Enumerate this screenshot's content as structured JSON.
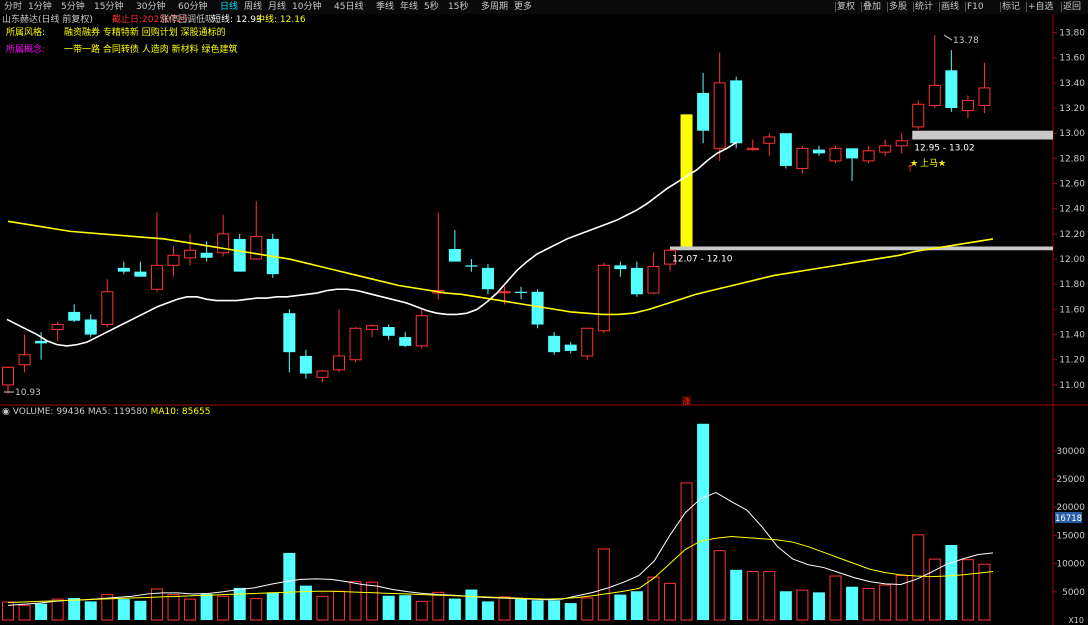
{
  "toolbar": {
    "periods": [
      "分时",
      "1分钟",
      "5分钟",
      "15分钟",
      "30分钟",
      "60分钟",
      "日线",
      "周线",
      "月线",
      "10分钟",
      "45日线",
      "季线",
      "年线",
      "5秒",
      "15秒",
      "多周期",
      "更多"
    ],
    "active_period": "日线",
    "right_buttons": [
      "复权",
      "叠加",
      "多股",
      "统计",
      "画线",
      "F10",
      "标记",
      "+自选",
      "返回"
    ]
  },
  "header": {
    "stock": "山东赫达(日线 前复权)",
    "date": "截止日:20250725",
    "strategy": "涨停回调低吸",
    "line1": "短线: 12.93",
    "line2": "中线: 12.16"
  },
  "info": {
    "style_label": "所属风格:",
    "style_value": "融资融券 专精特新 回购计划 深股通标的",
    "concept_label": "所属概念:",
    "concept_value": "一带一路 合同转债 人造肉 新材料 绿色建筑"
  },
  "volume_header": {
    "volume": "VOLUME: 99436",
    "ma5": "MA5: 119580",
    "ma10": "MA10: 85655"
  },
  "volume_badge": "16718",
  "volume_unit": "X10",
  "colors": {
    "up": "#ff3232",
    "down": "#54ffff",
    "short_line": "#ffffff",
    "mid_line": "#ffff00",
    "marker": "#ffff00",
    "zone": "#c8c8c8"
  },
  "chart_data": {
    "type": "candlestick",
    "price_axis": {
      "ylim": [
        10.88,
        13.86
      ],
      "ticks": [
        11.0,
        11.2,
        11.4,
        11.6,
        11.8,
        12.0,
        12.2,
        12.4,
        12.6,
        12.8,
        13.0,
        13.2,
        13.4,
        13.6,
        13.8
      ],
      "tick_labels": [
        "11.00",
        "11.20",
        "11.40",
        "11.60",
        "11.80",
        "12.00",
        "12.20",
        "12.40",
        "12.60",
        "12.80",
        "13.00",
        "13.20",
        "13.40",
        "13.60",
        "13.80"
      ]
    },
    "volume_axis": {
      "ylim": [
        0,
        36000
      ],
      "ticks": [
        5000,
        10000,
        15000,
        20000,
        25000,
        30000
      ],
      "tick_labels": [
        "5000",
        "10000",
        "15000",
        "20000",
        "25000",
        "30000"
      ]
    },
    "candles": [
      {
        "o": 11.0,
        "h": 11.15,
        "l": 10.93,
        "c": 11.14
      },
      {
        "o": 11.16,
        "h": 11.4,
        "l": 11.1,
        "c": 11.24
      },
      {
        "o": 11.35,
        "h": 11.42,
        "l": 11.2,
        "c": 11.33
      },
      {
        "o": 11.44,
        "h": 11.5,
        "l": 11.35,
        "c": 11.48
      },
      {
        "o": 11.58,
        "h": 11.64,
        "l": 11.5,
        "c": 11.51
      },
      {
        "o": 11.52,
        "h": 11.56,
        "l": 11.38,
        "c": 11.4
      },
      {
        "o": 11.48,
        "h": 11.84,
        "l": 11.46,
        "c": 11.74
      },
      {
        "o": 11.93,
        "h": 11.98,
        "l": 11.88,
        "c": 11.9
      },
      {
        "o": 11.9,
        "h": 11.98,
        "l": 11.86,
        "c": 11.86
      },
      {
        "o": 11.76,
        "h": 12.37,
        "l": 11.74,
        "c": 11.95
      },
      {
        "o": 11.95,
        "h": 12.1,
        "l": 11.86,
        "c": 12.03
      },
      {
        "o": 12.01,
        "h": 12.2,
        "l": 11.95,
        "c": 12.07
      },
      {
        "o": 12.05,
        "h": 12.14,
        "l": 11.98,
        "c": 12.01
      },
      {
        "o": 12.05,
        "h": 12.35,
        "l": 12.02,
        "c": 12.2
      },
      {
        "o": 12.16,
        "h": 12.2,
        "l": 11.92,
        "c": 11.9
      },
      {
        "o": 12.0,
        "h": 12.46,
        "l": 12.0,
        "c": 12.18
      },
      {
        "o": 12.16,
        "h": 12.2,
        "l": 11.85,
        "c": 11.88
      },
      {
        "o": 11.57,
        "h": 11.6,
        "l": 11.1,
        "c": 11.26
      },
      {
        "o": 11.23,
        "h": 11.28,
        "l": 11.05,
        "c": 11.09
      },
      {
        "o": 11.06,
        "h": 11.12,
        "l": 11.02,
        "c": 11.11
      },
      {
        "o": 11.12,
        "h": 11.6,
        "l": 11.1,
        "c": 11.23
      },
      {
        "o": 11.2,
        "h": 11.46,
        "l": 11.18,
        "c": 11.45
      },
      {
        "o": 11.44,
        "h": 11.48,
        "l": 11.38,
        "c": 11.47
      },
      {
        "o": 11.46,
        "h": 11.48,
        "l": 11.36,
        "c": 11.39
      },
      {
        "o": 11.38,
        "h": 11.42,
        "l": 11.3,
        "c": 11.31
      },
      {
        "o": 11.31,
        "h": 11.6,
        "l": 11.29,
        "c": 11.55
      },
      {
        "o": 11.73,
        "h": 12.37,
        "l": 11.68,
        "c": 11.75
      },
      {
        "o": 12.08,
        "h": 12.23,
        "l": 11.98,
        "c": 11.98
      },
      {
        "o": 11.95,
        "h": 12.0,
        "l": 11.9,
        "c": 11.94
      },
      {
        "o": 11.93,
        "h": 11.96,
        "l": 11.72,
        "c": 11.76
      },
      {
        "o": 11.74,
        "h": 11.78,
        "l": 11.64,
        "c": 11.74
      },
      {
        "o": 11.74,
        "h": 11.78,
        "l": 11.68,
        "c": 11.73
      },
      {
        "o": 11.74,
        "h": 11.76,
        "l": 11.45,
        "c": 11.48
      },
      {
        "o": 11.39,
        "h": 11.42,
        "l": 11.24,
        "c": 11.26
      },
      {
        "o": 11.32,
        "h": 11.34,
        "l": 11.25,
        "c": 11.27
      },
      {
        "o": 11.23,
        "h": 11.44,
        "l": 11.2,
        "c": 11.45
      },
      {
        "o": 11.43,
        "h": 11.97,
        "l": 11.41,
        "c": 11.95
      },
      {
        "o": 11.95,
        "h": 11.98,
        "l": 11.86,
        "c": 11.92
      },
      {
        "o": 11.93,
        "h": 11.98,
        "l": 11.7,
        "c": 11.72
      },
      {
        "o": 11.73,
        "h": 12.05,
        "l": 11.72,
        "c": 11.94
      },
      {
        "o": 11.96,
        "h": 12.08,
        "l": 11.9,
        "c": 12.07
      },
      {
        "o": 12.17,
        "h": 13.15,
        "l": 12.17,
        "c": 13.15
      },
      {
        "o": 13.32,
        "h": 13.48,
        "l": 12.92,
        "c": 13.02
      },
      {
        "o": 12.88,
        "h": 13.64,
        "l": 12.78,
        "c": 13.4
      },
      {
        "o": 13.42,
        "h": 13.45,
        "l": 12.88,
        "c": 12.92
      },
      {
        "o": 12.87,
        "h": 12.95,
        "l": 12.86,
        "c": 12.88
      },
      {
        "o": 12.92,
        "h": 13.0,
        "l": 12.82,
        "c": 12.97
      },
      {
        "o": 13.0,
        "h": 13.0,
        "l": 12.72,
        "c": 12.74
      },
      {
        "o": 12.72,
        "h": 12.9,
        "l": 12.68,
        "c": 12.88
      },
      {
        "o": 12.87,
        "h": 12.9,
        "l": 12.82,
        "c": 12.84
      },
      {
        "o": 12.78,
        "h": 12.9,
        "l": 12.76,
        "c": 12.88
      },
      {
        "o": 12.88,
        "h": 12.88,
        "l": 12.62,
        "c": 12.8
      },
      {
        "o": 12.78,
        "h": 12.9,
        "l": 12.76,
        "c": 12.86
      },
      {
        "o": 12.85,
        "h": 12.95,
        "l": 12.82,
        "c": 12.9
      },
      {
        "o": 12.9,
        "h": 13.0,
        "l": 12.84,
        "c": 12.94
      },
      {
        "o": 13.05,
        "h": 13.26,
        "l": 13.03,
        "c": 13.23
      },
      {
        "o": 13.22,
        "h": 13.78,
        "l": 13.2,
        "c": 13.38
      },
      {
        "o": 13.5,
        "h": 13.66,
        "l": 13.17,
        "c": 13.2
      },
      {
        "o": 13.18,
        "h": 13.3,
        "l": 13.12,
        "c": 13.26
      },
      {
        "o": 13.22,
        "h": 13.56,
        "l": 13.16,
        "c": 13.36
      }
    ],
    "short_line": [
      11.52,
      11.48,
      11.44,
      11.4,
      11.35,
      11.32,
      11.31,
      11.32,
      11.34,
      11.38,
      11.42,
      11.46,
      11.5,
      11.54,
      11.58,
      11.62,
      11.65,
      11.68,
      11.7,
      11.7,
      11.68,
      11.67,
      11.67,
      11.67,
      11.68,
      11.69,
      11.69,
      11.7,
      11.7,
      11.71,
      11.72,
      11.73,
      11.75,
      11.76,
      11.76,
      11.75,
      11.73,
      11.71,
      11.69,
      11.67,
      11.65,
      11.62,
      11.59,
      11.57,
      11.56,
      11.56,
      11.57,
      11.6,
      11.66,
      11.73,
      11.82,
      11.91,
      11.98,
      12.04,
      12.08,
      12.12,
      12.16,
      12.19,
      12.22,
      12.25,
      12.28,
      12.31,
      12.35,
      12.39,
      12.44,
      12.5,
      12.56,
      12.61,
      12.66,
      12.71,
      12.78,
      12.84,
      12.88,
      12.93
    ],
    "short_x": [
      7,
      17,
      27,
      37,
      47,
      57,
      67,
      77,
      87,
      97,
      107,
      117,
      127,
      137,
      147,
      157,
      167,
      177,
      187,
      197,
      207,
      217,
      227,
      237,
      247,
      257,
      267,
      277,
      287,
      297,
      307,
      317,
      327,
      337,
      347,
      357,
      367,
      377,
      387,
      397,
      407,
      417,
      427,
      437,
      447,
      457,
      467,
      477,
      487,
      497,
      507,
      517,
      527,
      537,
      547,
      557,
      567,
      577,
      587,
      597,
      607,
      617,
      627,
      637,
      647,
      657,
      667,
      677,
      687,
      697,
      707,
      717,
      727,
      737
    ],
    "mid_line": [
      12.3,
      12.28,
      12.26,
      12.24,
      12.22,
      12.21,
      12.2,
      12.19,
      12.18,
      12.17,
      12.16,
      12.14,
      12.12,
      12.1,
      12.08,
      12.06,
      12.04,
      12.02,
      12.0,
      11.97,
      11.94,
      11.91,
      11.88,
      11.85,
      11.82,
      11.79,
      11.77,
      11.75,
      11.73,
      11.72,
      11.7,
      11.68,
      11.66,
      11.64,
      11.62,
      11.6,
      11.58,
      11.57,
      11.56,
      11.56,
      11.57,
      11.6,
      11.64,
      11.68,
      11.72,
      11.75,
      11.78,
      11.81,
      11.84,
      11.87,
      11.89,
      11.91,
      11.93,
      11.95,
      11.97,
      11.99,
      12.01,
      12.03,
      12.06,
      12.08,
      12.1,
      12.12,
      12.14,
      12.16
    ],
    "volumes": [
      3200,
      2600,
      2900,
      3700,
      3900,
      3300,
      4500,
      3700,
      3400,
      5500,
      4500,
      3700,
      4600,
      4200,
      5700,
      3800,
      4900,
      11900,
      6100,
      4200,
      5100,
      6800,
      6700,
      4300,
      4400,
      3300,
      4900,
      3800,
      5400,
      3300,
      4100,
      3700,
      3500,
      3500,
      3000,
      3900,
      12600,
      4500,
      5100,
      7600,
      6500,
      24300,
      34800,
      12300,
      8900,
      8600,
      8600,
      5100,
      5300,
      4900,
      7800,
      5900,
      5600,
      6200,
      7900,
      15100,
      10800,
      13300,
      10700,
      9900
    ],
    "ma5_vol": [
      2600,
      2800,
      3000,
      3300,
      3500,
      3600,
      3800,
      4000,
      4200,
      4600,
      4800,
      4800,
      4600,
      4700,
      5000,
      5400,
      5700,
      6300,
      6800,
      7200,
      7300,
      7200,
      6800,
      6300,
      6000,
      5400,
      5000,
      4700,
      4500,
      4400,
      4200,
      4000,
      3900,
      3800,
      3700,
      3600,
      3700,
      4300,
      4900,
      5700,
      6700,
      7900,
      10500,
      15000,
      19000,
      21500,
      22600,
      21000,
      19500,
      16500,
      13000,
      10800,
      9800,
      9300,
      8400,
      7500,
      6800,
      6400,
      6300,
      7200,
      8500,
      9900,
      10800,
      11600,
      11900
    ],
    "ma10_vol": [
      3100,
      3200,
      3300,
      3400,
      3500,
      3600,
      3700,
      3800,
      3900,
      4000,
      4100,
      4200,
      4300,
      4400,
      4500,
      4600,
      4700,
      4800,
      4900,
      5000,
      5100,
      5100,
      5000,
      4900,
      4800,
      4700,
      4600,
      4500,
      4400,
      4300,
      4200,
      4100,
      4000,
      3900,
      3800,
      3700,
      3800,
      4000,
      4300,
      4700,
      5100,
      5600,
      7500,
      10000,
      12500,
      14000,
      14500,
      14800,
      14600,
      14400,
      14200,
      13800,
      13000,
      12000,
      11000,
      10000,
      9000,
      8400,
      8000,
      7800,
      7700,
      7800,
      8000,
      8300,
      8600
    ],
    "annotations": {
      "low_label": "10.93",
      "high_label": "13.78",
      "zone_upper": "12.95 - 13.02",
      "zone_lower": "12.07 - 12.10",
      "signal": "上马",
      "rise_mark": "涨"
    }
  }
}
